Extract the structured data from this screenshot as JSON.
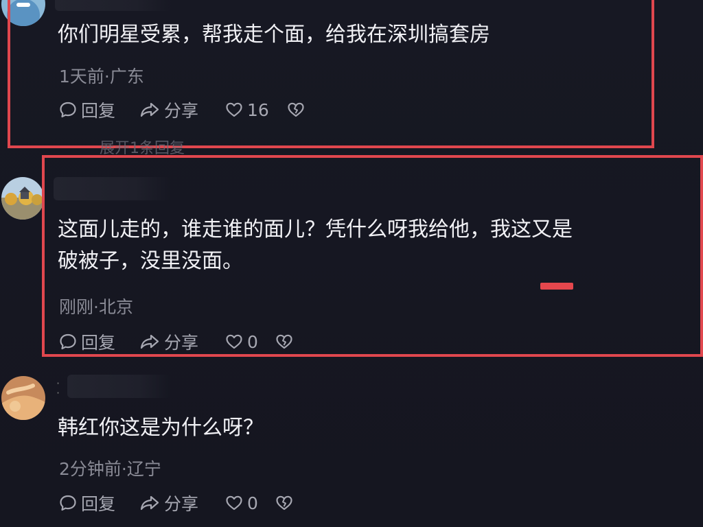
{
  "comments": [
    {
      "text": "你们明星受累，帮我走个面，给我在深圳搞套房",
      "meta": "1天前·广东",
      "reply_label": "回复",
      "share_label": "分享",
      "like_count": "16",
      "expand_label": "展开1条回复"
    },
    {
      "text_lines": [
        "这面儿走的，谁走谁的面儿？凭什么呀我给他，我这又是",
        "破被子，没里没面。"
      ],
      "meta": "刚刚·北京",
      "reply_label": "回复",
      "share_label": "分享",
      "like_count": "0"
    },
    {
      "text": "韩红你这是为什么呀？",
      "meta": "2分钟前·辽宁",
      "reply_label": "回复",
      "share_label": "分享",
      "like_count": "0"
    }
  ],
  "colors": {
    "background": "#161722",
    "highlight": "#e0474e",
    "text": "#f1f1f5",
    "meta": "#8a8b96"
  },
  "icons": [
    "comment-bubble-icon",
    "share-arrow-icon",
    "heart-icon",
    "broken-heart-icon"
  ]
}
